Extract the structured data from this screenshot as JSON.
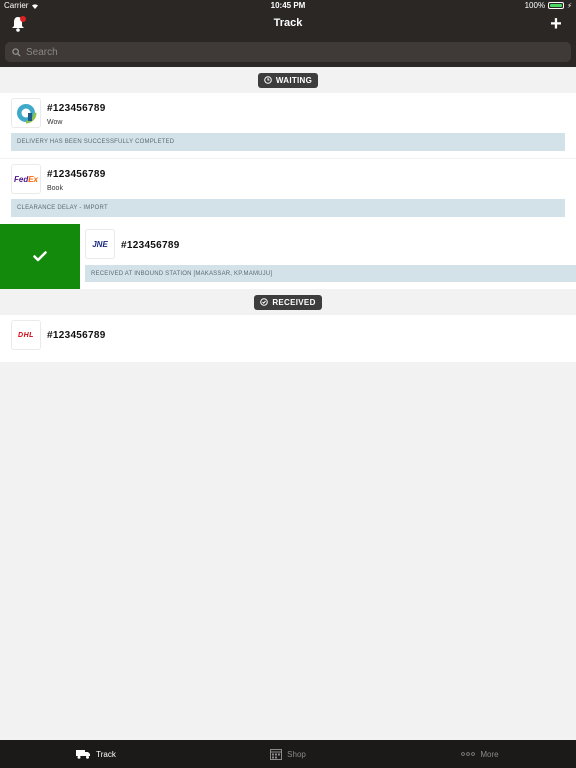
{
  "status_bar": {
    "carrier": "Carrier",
    "time": "10:45 PM",
    "battery": "100%"
  },
  "nav": {
    "title": "Track"
  },
  "search": {
    "placeholder": "Search"
  },
  "sections": {
    "waiting_label": "WAITING",
    "received_label": "RECEIVED"
  },
  "items": [
    {
      "number": "#123456789",
      "subtitle": "Wow",
      "status": "DELIVERY HAS BEEN SUCCESSFULLY COMPLETED",
      "logo": "wow-logo"
    },
    {
      "number": "#123456789",
      "subtitle": "Book",
      "status": "CLEARANCE DELAY - IMPORT",
      "logo": "fedex-logo",
      "logo_text_a": "Fed",
      "logo_text_b": "Ex"
    },
    {
      "number": "#123456789",
      "status": "RECEIVED AT INBOUND STATION [MAKASSAR, KP.MAMUJU]",
      "logo": "jne-logo",
      "logo_text": "JNE"
    },
    {
      "number": "#123456789",
      "logo": "dhl-logo",
      "logo_text": "DHL"
    }
  ],
  "tabs": [
    {
      "label": "Track",
      "icon": "truck-icon",
      "active": true
    },
    {
      "label": "Shop",
      "icon": "calendar-icon",
      "active": false
    },
    {
      "label": "More",
      "icon": "more-dots-icon",
      "active": false
    }
  ],
  "colors": {
    "header_bg": "#2b2725",
    "swipe_action": "#138a0c",
    "status_bg": "#d3e1e8",
    "badge_bg": "#3d3d3d",
    "tab_bar_bg": "#1c1a19"
  }
}
